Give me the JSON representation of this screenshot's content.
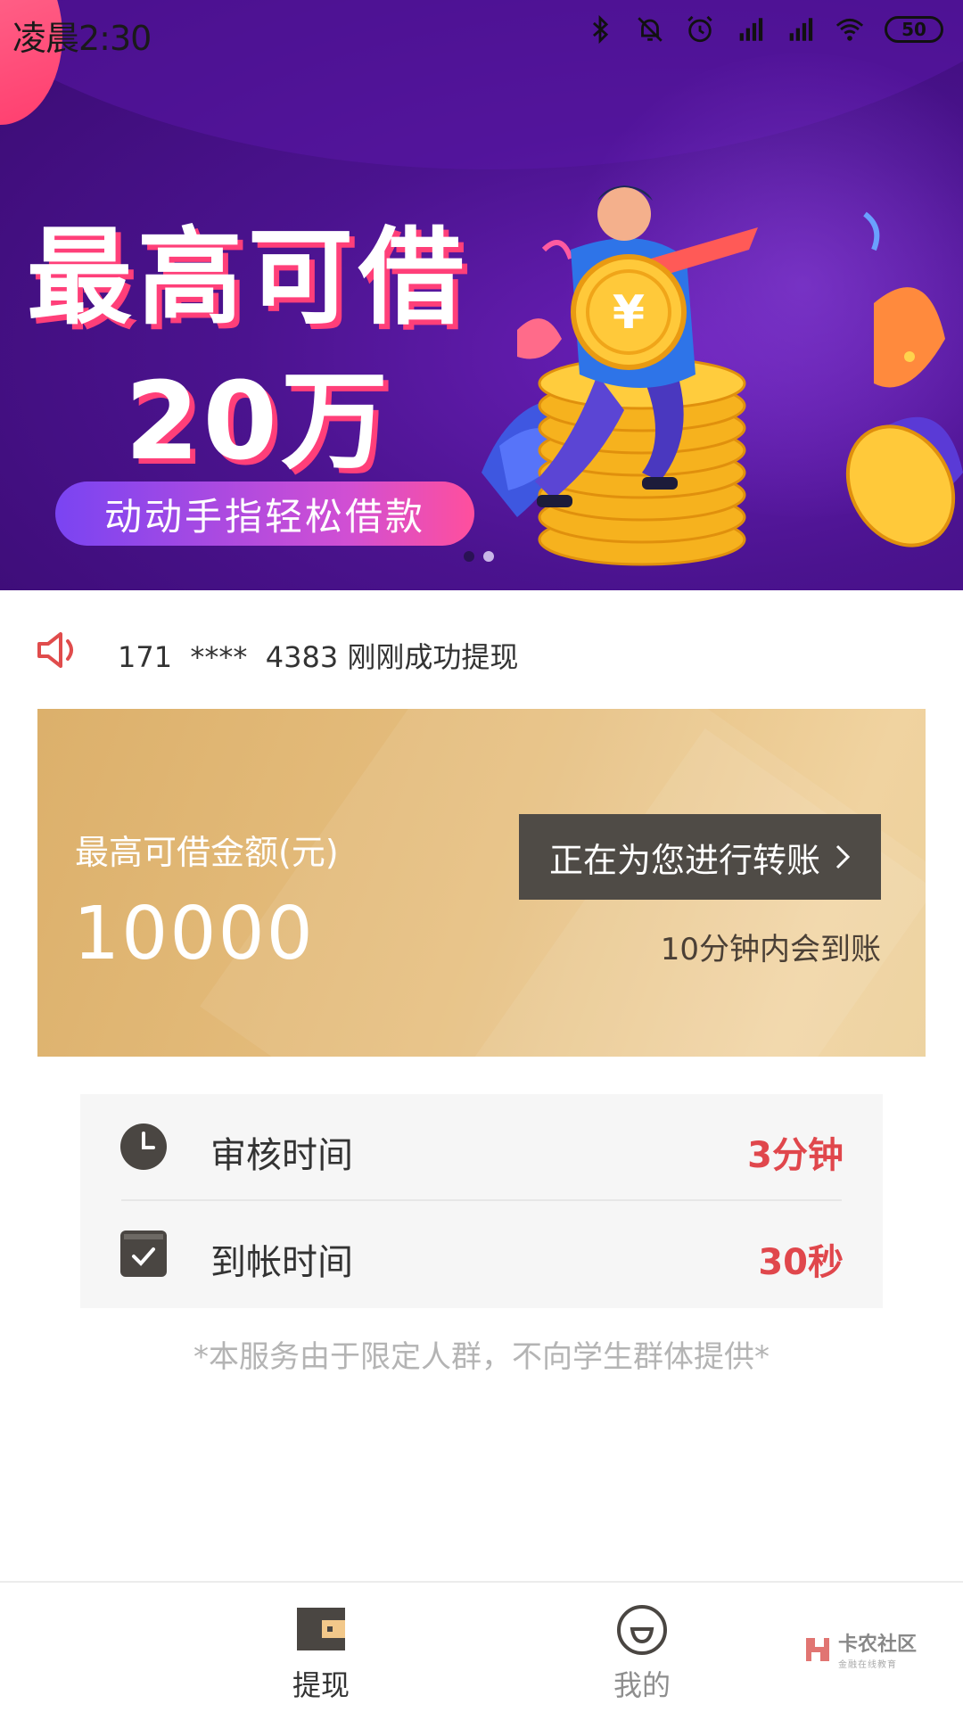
{
  "status_bar": {
    "time": "凌晨2:30",
    "battery": "50"
  },
  "banner": {
    "title": "最高可借",
    "amount": "20万",
    "pill": "动动手指轻松借款",
    "slide_count": 2,
    "active_slide": 1
  },
  "notice": {
    "phone": "171",
    "mask": "****",
    "suffix": "4383",
    "message": "刚刚成功提现"
  },
  "card": {
    "label": "最高可借金额(元)",
    "amount": "10000",
    "button_label": "正在为您进行转账",
    "note": "10分钟内会到账"
  },
  "info": [
    {
      "label": "审核时间",
      "value": "3分钟",
      "icon": "clock-icon"
    },
    {
      "label": "到帐时间",
      "value": "30秒",
      "icon": "check-calendar-icon"
    }
  ],
  "disclaimer": "*本服务由于限定人群，不向学生群体提供*",
  "bottom_nav": [
    {
      "label": "提现",
      "icon": "wallet-icon",
      "active": true
    },
    {
      "label": "我的",
      "icon": "profile-face-icon",
      "active": false
    }
  ],
  "watermark": {
    "title": "卡农社区",
    "subtitle": "金融在线教育"
  },
  "colors": {
    "banner": "#4b138f",
    "accent_pink": "#ff3f79",
    "gold": "#e6bf80",
    "button": "#4f4b46",
    "value_red": "#e0474c"
  }
}
